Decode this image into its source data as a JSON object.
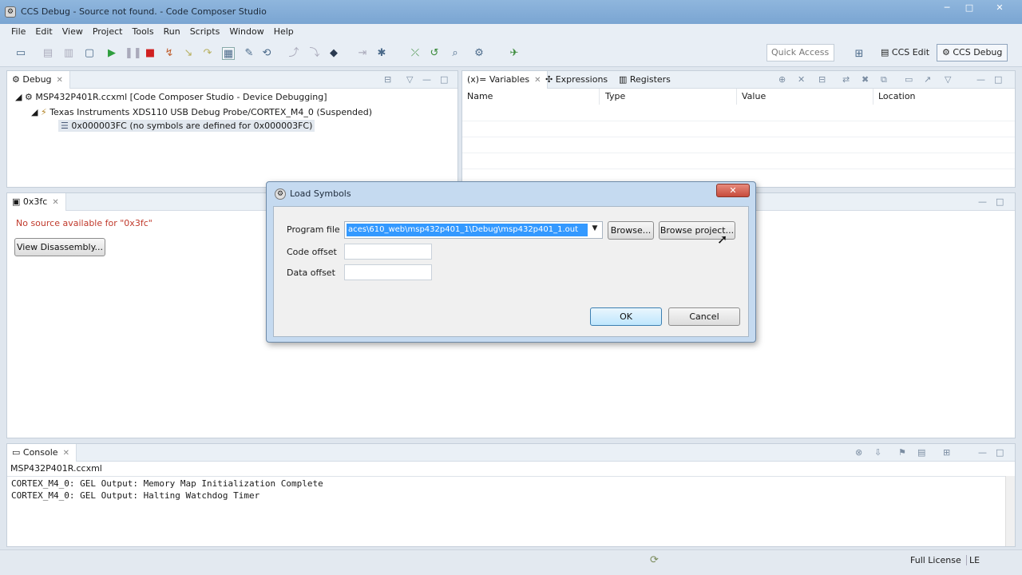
{
  "window": {
    "title": "CCS Debug - Source not found. - Code Composer Studio",
    "controls": {
      "minimize": "─",
      "maximize": "□",
      "close": "✕"
    }
  },
  "menu": [
    "File",
    "Edit",
    "View",
    "Project",
    "Tools",
    "Run",
    "Scripts",
    "Window",
    "Help"
  ],
  "toolbar": {
    "quick_access": "Quick Access",
    "perspectives": {
      "edit": "CCS Edit",
      "debug": "CCS Debug"
    }
  },
  "debug_view": {
    "tab": "Debug",
    "tree": {
      "session": "MSP432P401R.ccxml [Code Composer Studio - Device Debugging]",
      "target": "Texas Instruments XDS110 USB Debug Probe/CORTEX_M4_0 (Suspended)",
      "frame": "0x000003FC  (no symbols are defined for 0x000003FC)"
    }
  },
  "variables_view": {
    "tabs": {
      "variables": "Variables",
      "expressions": "Expressions",
      "registers": "Registers"
    },
    "columns": [
      "Name",
      "Type",
      "Value",
      "Location"
    ]
  },
  "editor": {
    "tab": "0x3fc",
    "message": "No source available for \"0x3fc\"",
    "button": "View Disassembly..."
  },
  "dialog": {
    "title": "Load Symbols",
    "close": "✕",
    "program_file_label": "Program file",
    "program_file_value": "aces\\610_web\\msp432p401_1\\Debug\\msp432p401_1.out",
    "browse": "Browse...",
    "browse_project": "Browse project...",
    "code_offset_label": "Code offset",
    "data_offset_label": "Data offset",
    "ok": "OK",
    "cancel": "Cancel"
  },
  "console": {
    "tab": "Console",
    "source": "MSP432P401R.ccxml",
    "lines": [
      "CORTEX_M4_0: GEL Output: Memory Map Initialization Complete",
      "CORTEX_M4_0: GEL Output: Halting Watchdog Timer"
    ]
  },
  "status": {
    "license": "Full License",
    "edition": "LE"
  },
  "colors": {
    "error_text": "#c0392b",
    "selection": "#3399ff",
    "titlebar": "#7aa5d2"
  }
}
